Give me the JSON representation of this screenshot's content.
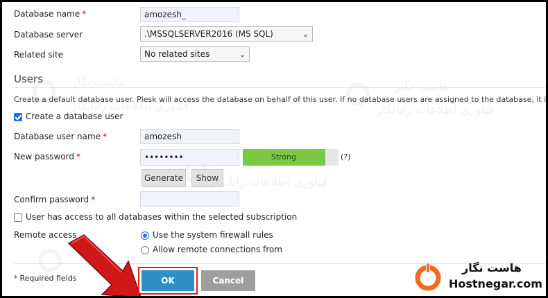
{
  "form": {
    "database_name_label": "Database name",
    "database_name_value": "amozesh_",
    "database_server_label": "Database server",
    "database_server_value": ".\\MSSQLSERVER2016 (MS SQL)",
    "related_site_label": "Related site",
    "related_site_value": "No related sites",
    "required_mark": "*"
  },
  "users": {
    "heading": "Users",
    "hint": "Create a default database user. Plesk will access the database on behalf of this user. If no database users are assigned to the database, it is not acces",
    "create_user_label": "Create a database user",
    "create_user_checked": true,
    "username_label": "Database user name",
    "username_value": "amozesh",
    "password_label": "New password",
    "password_value": "••••••••",
    "strength_label": "Strong",
    "strength_level": 0.86,
    "strength_color": "#7ac943",
    "help_text": "(?)",
    "generate_label": "Generate",
    "show_label": "Show",
    "confirm_label": "Confirm password",
    "all_db_access_label": "User has access to all databases within the selected subscription",
    "all_db_access_checked": false,
    "remote_access_label": "Remote access",
    "remote_options": [
      "Use the system firewall rules",
      "Allow remote connections from"
    ],
    "remote_selected": 0
  },
  "footer": {
    "required_note": "Required fields",
    "ok_label": "OK",
    "cancel_label": "Cancel"
  },
  "watermark": {
    "brand_fa": "هاست نگار",
    "tagline_fa": "فناوری اطلاعات رایانگار"
  },
  "branding": {
    "name_fa": "هاست نگار",
    "domain": "Hostnegar.com",
    "logo_color": "#f26a1b"
  },
  "annotation": {
    "arrow_color": "#d01818",
    "highlight_color": "#e21b1b"
  }
}
